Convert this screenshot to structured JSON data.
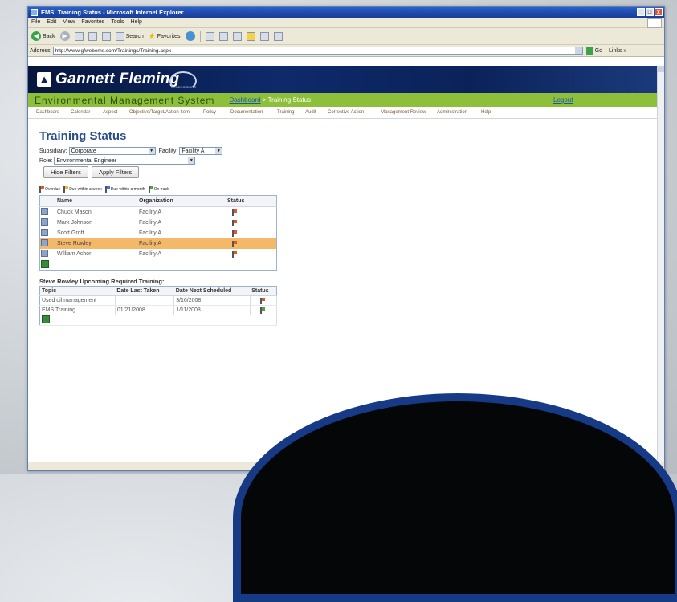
{
  "window": {
    "title": "EMS: Training Status - Microsoft Internet Explorer",
    "controls": [
      "_",
      "□",
      "x"
    ]
  },
  "menu": [
    "File",
    "Edit",
    "View",
    "Favorites",
    "Tools",
    "Help"
  ],
  "toolbar": {
    "back": "Back",
    "search": "Search",
    "favorites": "Favorites"
  },
  "address": {
    "label": "Address",
    "url": "http://www.gfwebems.com/Trainings/Training.aspx",
    "go": "Go",
    "links": "Links »"
  },
  "brand": {
    "name": "Gannett Fleming",
    "sub": "GEODECISIONS"
  },
  "header": {
    "system": "Environmental Management System",
    "crumb_link": "Dashboard",
    "crumb_sep": " > ",
    "crumb_current": "Training Status",
    "logout": "Logout"
  },
  "nav": [
    "Dashboard",
    "Calendar",
    "Aspect",
    "Objective/Target/Action Item",
    "Policy",
    "Documentation",
    "Training",
    "Audit",
    "Corrective Action",
    "Management Review",
    "Administration",
    "Help"
  ],
  "page": {
    "title": "Training Status",
    "subsidiary_label": "Subsidiary:",
    "subsidiary_value": "Corporate",
    "facility_label": "Facility:",
    "facility_value": "Facility A",
    "role_label": "Role:",
    "role_value": "Environmental Engineer",
    "hide_filters": "Hide Filters",
    "apply_filters": "Apply Filters"
  },
  "legend": {
    "overdue": "Overdue",
    "week": "Due within a week",
    "month": "Due within a month",
    "track": "On track"
  },
  "colors": {
    "overdue": "#e2572a",
    "week": "#f2b233",
    "month": "#3a7bd5",
    "track": "#47a447",
    "selected_row": "#f3b969"
  },
  "staff_table": {
    "headers": [
      "Name",
      "Organization",
      "Status"
    ],
    "rows": [
      {
        "name": "Chuck Mason",
        "org": "Facility A",
        "status": "overdue"
      },
      {
        "name": "Mark Johnson",
        "org": "Facility A",
        "status": "overdue"
      },
      {
        "name": "Scott Groft",
        "org": "Facility A",
        "status": "overdue"
      },
      {
        "name": "Steve Rowley",
        "org": "Facility A",
        "status": "overdue",
        "selected": true
      },
      {
        "name": "William Achor",
        "org": "Facility A",
        "status": "overdue"
      }
    ]
  },
  "upcoming": {
    "title": "Steve Rowley Upcoming Required Training:",
    "headers": [
      "Topic",
      "Date Last Taken",
      "Date Next Scheduled",
      "Status"
    ],
    "rows": [
      {
        "topic": "Used oil management",
        "last": "",
        "next": "3/16/2008",
        "status": "overdue"
      },
      {
        "topic": "EMS Training",
        "last": "01/21/2008",
        "next": "1/11/2008",
        "status": "track"
      }
    ]
  }
}
